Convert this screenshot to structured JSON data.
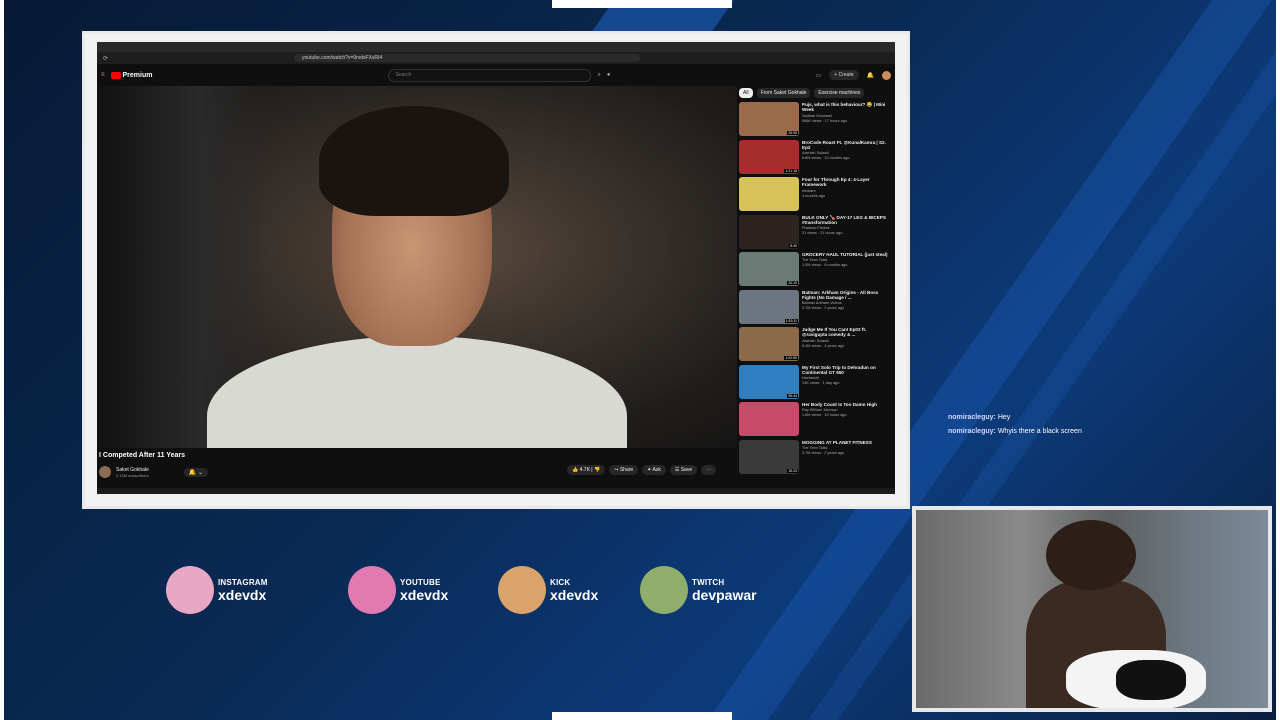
{
  "browser": {
    "tabs": [
      "",
      "",
      ""
    ],
    "url": "youtube.com/watch?v=9rvdsFXsRI4"
  },
  "youtube": {
    "logo": "Premium",
    "search_placeholder": "Search",
    "create_label": "+ Create",
    "video_title": "I Competed After 11 Years",
    "channel_name": "Saket Gokhale",
    "channel_subs": "2.15M subscribers",
    "actions": {
      "like": "4.7K",
      "share": "Share",
      "ask": "Ask",
      "save": "Save"
    },
    "chips": [
      "All",
      "From Saket Gokhale",
      "Exercise machines"
    ],
    "recommendations": [
      {
        "title": "Pujs, what is this behaviour? 😂 | Mini Week",
        "channel": "Sarthak Goswami",
        "stats": "966K views · 17 hours ago",
        "duration": "25:55",
        "color": "#9b6a4b"
      },
      {
        "title": "BroCode Roast Ft. @KunalKamra | S2. Ep2",
        "channel": "Aashish Solanki",
        "stats": "6.8M views · 10 months ago",
        "duration": "1:21:18",
        "color": "#a62d2d"
      },
      {
        "title": "Four for Through Ep 4: 4-Layer Framework",
        "channel": "Infotainr",
        "stats": "4 months ago",
        "duration": "",
        "color": "#d8c25a"
      },
      {
        "title": "BULK ONLY 🍗 DAY-17 LEG & BICEPS #transformation",
        "channel": "Pradeep Fitness",
        "stats": "31 views · 21 hours ago",
        "duration": "8:40",
        "color": "#2d2420"
      },
      {
        "title": "GROCERY HAUL TUTORIAL (just steal)",
        "channel": "The Teen Talks",
        "stats": "1.5M views · 6 months ago",
        "duration": "20:19",
        "color": "#6a7a74"
      },
      {
        "title": "Batman: Arkham Origins - All Boss Fights (No Damage / ...",
        "channel": "Batman Arkham Videos",
        "stats": "3.7M views · 2 years ago",
        "duration": "1:53:11",
        "color": "#6d7580"
      },
      {
        "title": "Judge Me If You Can! Ep02 ft. @ravigupta comedy & ...",
        "channel": "Aashish Solanki",
        "stats": "5.4M views · 4 years ago",
        "duration": "1:02:50",
        "color": "#8a6a48"
      },
      {
        "title": "My First Solo Trip to Dehradun on Continental GT 650",
        "channel": "Neelanshi",
        "stats": "13K views · 1 day ago",
        "duration": "55:44",
        "color": "#2f7fc0"
      },
      {
        "title": "Her Body Count Is Too Damn High",
        "channel": "Ray William Johnson",
        "stats": "1.8M views · 10 hours ago",
        "duration": "",
        "color": "#c74a6a"
      },
      {
        "title": "MOGGING AT PLANET FITNESS",
        "channel": "The Teen Talks",
        "stats": "3.7M views · 2 years ago",
        "duration": "15:23",
        "color": "#3b3a3a"
      }
    ]
  },
  "chat": [
    {
      "user": "nomiracleguy:",
      "message": "Hey"
    },
    {
      "user": "nomiracleguy:",
      "message": "Whyis there a black screen"
    }
  ],
  "socials": [
    {
      "platform": "INSTAGRAM",
      "handle": "xdevdx",
      "color": "#e9a7c6"
    },
    {
      "platform": "YOUTUBE",
      "handle": "xdevdx",
      "color": "#e07ab0"
    },
    {
      "platform": "KICK",
      "handle": "xdevdx",
      "color": "#d9a36a"
    },
    {
      "platform": "TWITCH",
      "handle": "devpawar",
      "color": "#8fae6b"
    }
  ]
}
